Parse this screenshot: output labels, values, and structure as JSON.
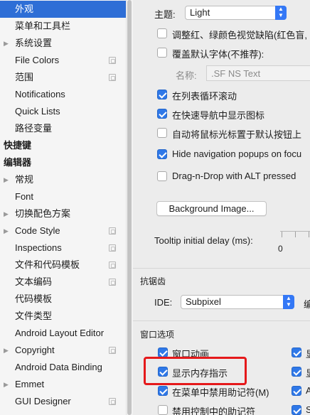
{
  "sidebar": {
    "items": [
      {
        "label": "外观",
        "level": 1,
        "selected": true,
        "arrow": false,
        "project_icon": false,
        "bold": false
      },
      {
        "label": "菜单和工具栏",
        "level": 1,
        "selected": false,
        "arrow": false,
        "project_icon": false,
        "bold": false
      },
      {
        "label": "系统设置",
        "level": 1,
        "selected": false,
        "arrow": true,
        "project_icon": false,
        "bold": false
      },
      {
        "label": "File Colors",
        "level": 1,
        "selected": false,
        "arrow": false,
        "project_icon": true,
        "bold": false
      },
      {
        "label": "范围",
        "level": 1,
        "selected": false,
        "arrow": false,
        "project_icon": true,
        "bold": false
      },
      {
        "label": "Notifications",
        "level": 1,
        "selected": false,
        "arrow": false,
        "project_icon": false,
        "bold": false
      },
      {
        "label": "Quick Lists",
        "level": 1,
        "selected": false,
        "arrow": false,
        "project_icon": false,
        "bold": false
      },
      {
        "label": "路径变量",
        "level": 1,
        "selected": false,
        "arrow": false,
        "project_icon": false,
        "bold": false
      },
      {
        "label": "快捷键",
        "level": 0,
        "selected": false,
        "arrow": false,
        "project_icon": false,
        "bold": true
      },
      {
        "label": "编辑器",
        "level": 0,
        "selected": false,
        "arrow": false,
        "project_icon": false,
        "bold": true
      },
      {
        "label": "常规",
        "level": 1,
        "selected": false,
        "arrow": true,
        "project_icon": false,
        "bold": false
      },
      {
        "label": "Font",
        "level": 1,
        "selected": false,
        "arrow": false,
        "project_icon": false,
        "bold": false
      },
      {
        "label": "切换配色方案",
        "level": 1,
        "selected": false,
        "arrow": true,
        "project_icon": false,
        "bold": false
      },
      {
        "label": "Code Style",
        "level": 1,
        "selected": false,
        "arrow": true,
        "project_icon": true,
        "bold": false
      },
      {
        "label": "Inspections",
        "level": 1,
        "selected": false,
        "arrow": false,
        "project_icon": true,
        "bold": false
      },
      {
        "label": "文件和代码模板",
        "level": 1,
        "selected": false,
        "arrow": false,
        "project_icon": true,
        "bold": false
      },
      {
        "label": "文本编码",
        "level": 1,
        "selected": false,
        "arrow": false,
        "project_icon": true,
        "bold": false
      },
      {
        "label": "代码模板",
        "level": 1,
        "selected": false,
        "arrow": false,
        "project_icon": false,
        "bold": false
      },
      {
        "label": "文件类型",
        "level": 1,
        "selected": false,
        "arrow": false,
        "project_icon": false,
        "bold": false
      },
      {
        "label": "Android Layout Editor",
        "level": 1,
        "selected": false,
        "arrow": false,
        "project_icon": false,
        "bold": false
      },
      {
        "label": "Copyright",
        "level": 1,
        "selected": false,
        "arrow": true,
        "project_icon": true,
        "bold": false
      },
      {
        "label": "Android Data Binding",
        "level": 1,
        "selected": false,
        "arrow": false,
        "project_icon": false,
        "bold": false
      },
      {
        "label": "Emmet",
        "level": 1,
        "selected": false,
        "arrow": true,
        "project_icon": false,
        "bold": false
      },
      {
        "label": "GUI Designer",
        "level": 1,
        "selected": false,
        "arrow": false,
        "project_icon": true,
        "bold": false
      }
    ]
  },
  "main": {
    "theme": {
      "label": "主题:",
      "value": "Light"
    },
    "options": [
      {
        "label": "调整红、绿颜色视觉缺陷(红色盲,",
        "checked": false
      },
      {
        "label": "覆盖默认字体(不推荐):",
        "checked": false
      },
      {
        "label": "在列表循环滚动",
        "checked": true
      },
      {
        "label": "在快速导航中显示图标",
        "checked": true
      },
      {
        "label": "自动将鼠标光标置于默认按钮上",
        "checked": false
      },
      {
        "label": "Hide navigation popups on focu",
        "checked": true
      },
      {
        "label": "Drag-n-Drop with ALT pressed",
        "checked": false
      }
    ],
    "font_name": {
      "label": "名称:",
      "placeholder": ".SF NS Text"
    },
    "background_button": "Background Image...",
    "tooltip": {
      "label": "Tooltip initial delay (ms):",
      "value": "0"
    },
    "antialiasing": {
      "section": "抗锯齿",
      "ide_label": "IDE:",
      "ide_value": "Subpixel",
      "editor_label_clipped": "编"
    },
    "window_options": {
      "section": "窗口选项",
      "items": [
        {
          "label": "窗口动画",
          "checked": true
        },
        {
          "label": "显示内存指示",
          "checked": true
        },
        {
          "label": "在菜单中禁用助记符(M)",
          "checked": true
        },
        {
          "label": "禁用控制中的助记符",
          "checked": false
        }
      ],
      "right_column_clipped": [
        {
          "label": "显",
          "checked": true
        },
        {
          "label": "显",
          "checked": true
        },
        {
          "label": "A",
          "checked": true
        },
        {
          "label": "S",
          "checked": true
        }
      ]
    },
    "highlight_color": "#e5191b",
    "accent_color": "#2f78e8"
  }
}
